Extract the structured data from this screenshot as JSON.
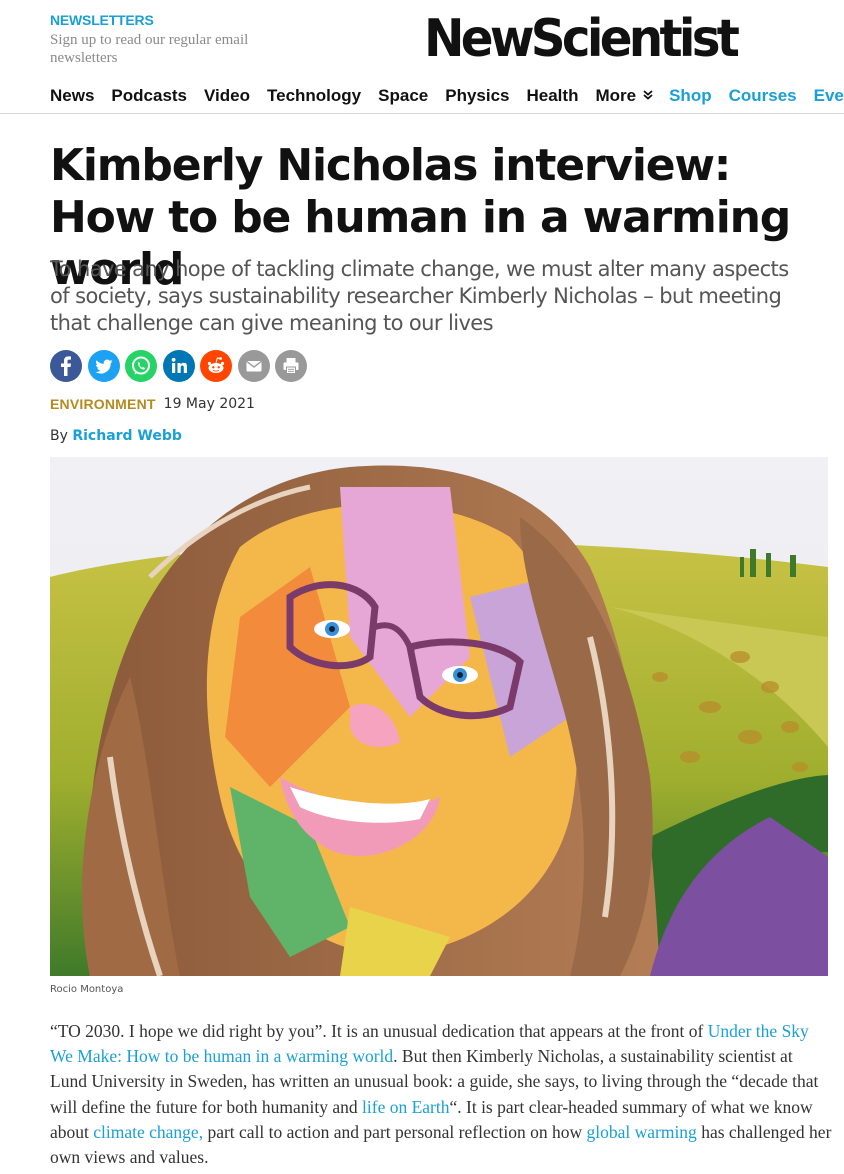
{
  "newsletters": {
    "label": "NEWSLETTERS",
    "sub": "Sign up to read our regular email newsletters"
  },
  "logo": "NewScientist",
  "nav": {
    "items": [
      "News",
      "Podcasts",
      "Video",
      "Technology",
      "Space",
      "Physics",
      "Health",
      "More"
    ],
    "more_icon": "double-chevron-down-icon",
    "accent_items": [
      "Shop",
      "Courses",
      "Events"
    ]
  },
  "article": {
    "headline": "Kimberly Nicholas interview: How to be human in a warming world",
    "standfirst": "To have any hope of tackling climate change, we must alter many aspects of society, says sustainability researcher Kimberly Nicholas – but meeting that challenge can give meaning to our lives",
    "section": "ENVIRONMENT",
    "date": "19 May 2021",
    "byline_prefix": "By",
    "author": "Richard Webb",
    "image_caption": "Rocio Montoya"
  },
  "share": [
    {
      "name": "facebook-icon",
      "glyph": "f",
      "color": "#3b5998"
    },
    {
      "name": "twitter-icon",
      "glyph": "t",
      "color": "#1da1f2"
    },
    {
      "name": "whatsapp-icon",
      "glyph": "w",
      "color": "#25d366"
    },
    {
      "name": "linkedin-icon",
      "glyph": "in",
      "color": "#0077b5"
    },
    {
      "name": "reddit-icon",
      "glyph": "r",
      "color": "#ff4500"
    },
    {
      "name": "email-icon",
      "glyph": "✉",
      "color": "#999999"
    },
    {
      "name": "print-icon",
      "glyph": "⎙",
      "color": "#999999"
    }
  ],
  "body": {
    "p1_a": "“TO 2030. I hope we did right by you”. It is an unusual dedication that appears at the front of ",
    "p1_link1": "Under the Sky We Make: How to be human in a warming world",
    "p1_b": ". But then Kimberly Nicholas, a sustainability scientist at Lund University in Sweden, has written an unusual book: a guide, she says, to living through the “decade that will define the future for both humanity and ",
    "p1_link2": "life on Earth",
    "p1_c": "“. It is part clear-headed summary of what we know about ",
    "p1_link3": "climate change,",
    "p1_d": " part call to action and part personal reflection on how ",
    "p1_link4": "global warming",
    "p1_e": " has challenged her own views and values."
  },
  "colors": {
    "accent": "#1a9fd6",
    "section": "#b58a1f"
  }
}
